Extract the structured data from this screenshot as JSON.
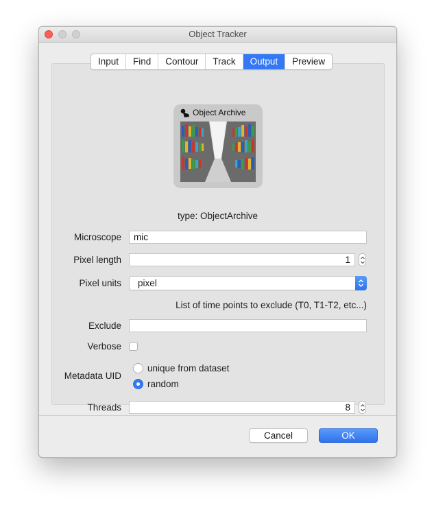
{
  "window": {
    "title": "Object Tracker"
  },
  "tabs": [
    {
      "label": "Input",
      "active": false
    },
    {
      "label": "Find",
      "active": false
    },
    {
      "label": "Contour",
      "active": false
    },
    {
      "label": "Track",
      "active": false
    },
    {
      "label": "Output",
      "active": true
    },
    {
      "label": "Preview",
      "active": false
    }
  ],
  "module": {
    "title": "Object Archive",
    "icon": "tag-icon",
    "image": "library-bookshelves-illustration",
    "type_text": "type: ObjectArchive"
  },
  "form": {
    "microscope": {
      "label": "Microscope",
      "value": "mic"
    },
    "pixel_length": {
      "label": "Pixel length",
      "value": "1"
    },
    "pixel_units": {
      "label": "Pixel units",
      "value": "pixel"
    },
    "exclude_hint": "List of time points to exclude (T0, T1-T2, etc...)",
    "exclude": {
      "label": "Exclude",
      "value": ""
    },
    "verbose": {
      "label": "Verbose",
      "checked": false
    },
    "metadata_uid": {
      "label": "Metadata UID",
      "options": [
        {
          "label": "unique from dataset",
          "checked": false
        },
        {
          "label": "random",
          "checked": true
        }
      ]
    },
    "threads": {
      "label": "Threads",
      "value": "8"
    }
  },
  "buttons": {
    "cancel": "Cancel",
    "ok": "OK"
  },
  "colors": {
    "accent": "#3478f6",
    "close": "#fd5f57"
  }
}
